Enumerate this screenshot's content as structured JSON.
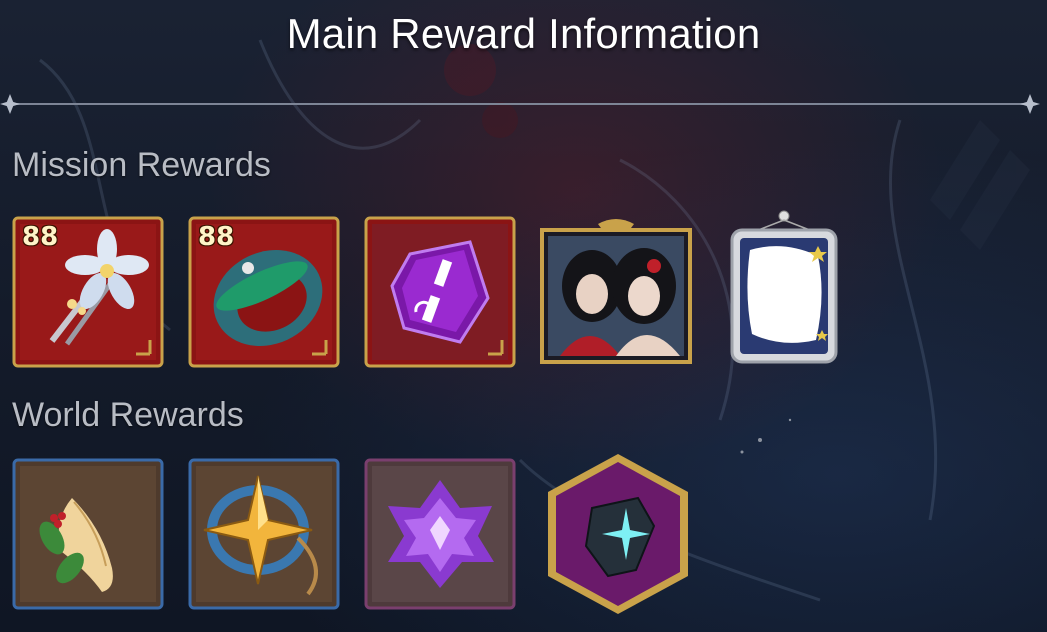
{
  "header": {
    "title": "Main Reward Information"
  },
  "mission_rewards": {
    "label": "Mission Rewards",
    "items": [
      {
        "name": "flower-hairpin",
        "badge": "88",
        "frame": "red",
        "icon": "hairpin-icon"
      },
      {
        "name": "jade-ring",
        "badge": "88",
        "frame": "red",
        "icon": "ring-icon"
      },
      {
        "name": "purple-rune-stone",
        "badge": "",
        "frame": "red",
        "icon": "rune-stone-icon"
      },
      {
        "name": "character-portrait",
        "badge": "",
        "frame": "gold",
        "icon": "portrait-icon"
      },
      {
        "name": "blank-frame",
        "badge": "",
        "frame": "silver",
        "icon": "frame-icon"
      }
    ]
  },
  "world_rewards": {
    "label": "World Rewards",
    "items": [
      {
        "name": "ginseng-root",
        "frame": "blue",
        "icon": "ginseng-icon"
      },
      {
        "name": "star-compass",
        "frame": "blue",
        "icon": "star-compass-icon"
      },
      {
        "name": "purple-crystal-cluster",
        "frame": "purple",
        "icon": "crystal-cluster-icon"
      },
      {
        "name": "dark-shard",
        "frame": "hexagon-purple",
        "icon": "shard-icon"
      }
    ]
  },
  "colors": {
    "red_frame": "#8b1414",
    "blue_frame": "#3a6aa8",
    "purple_frame": "#7a3f6e",
    "gold_border": "#c9a24a"
  }
}
